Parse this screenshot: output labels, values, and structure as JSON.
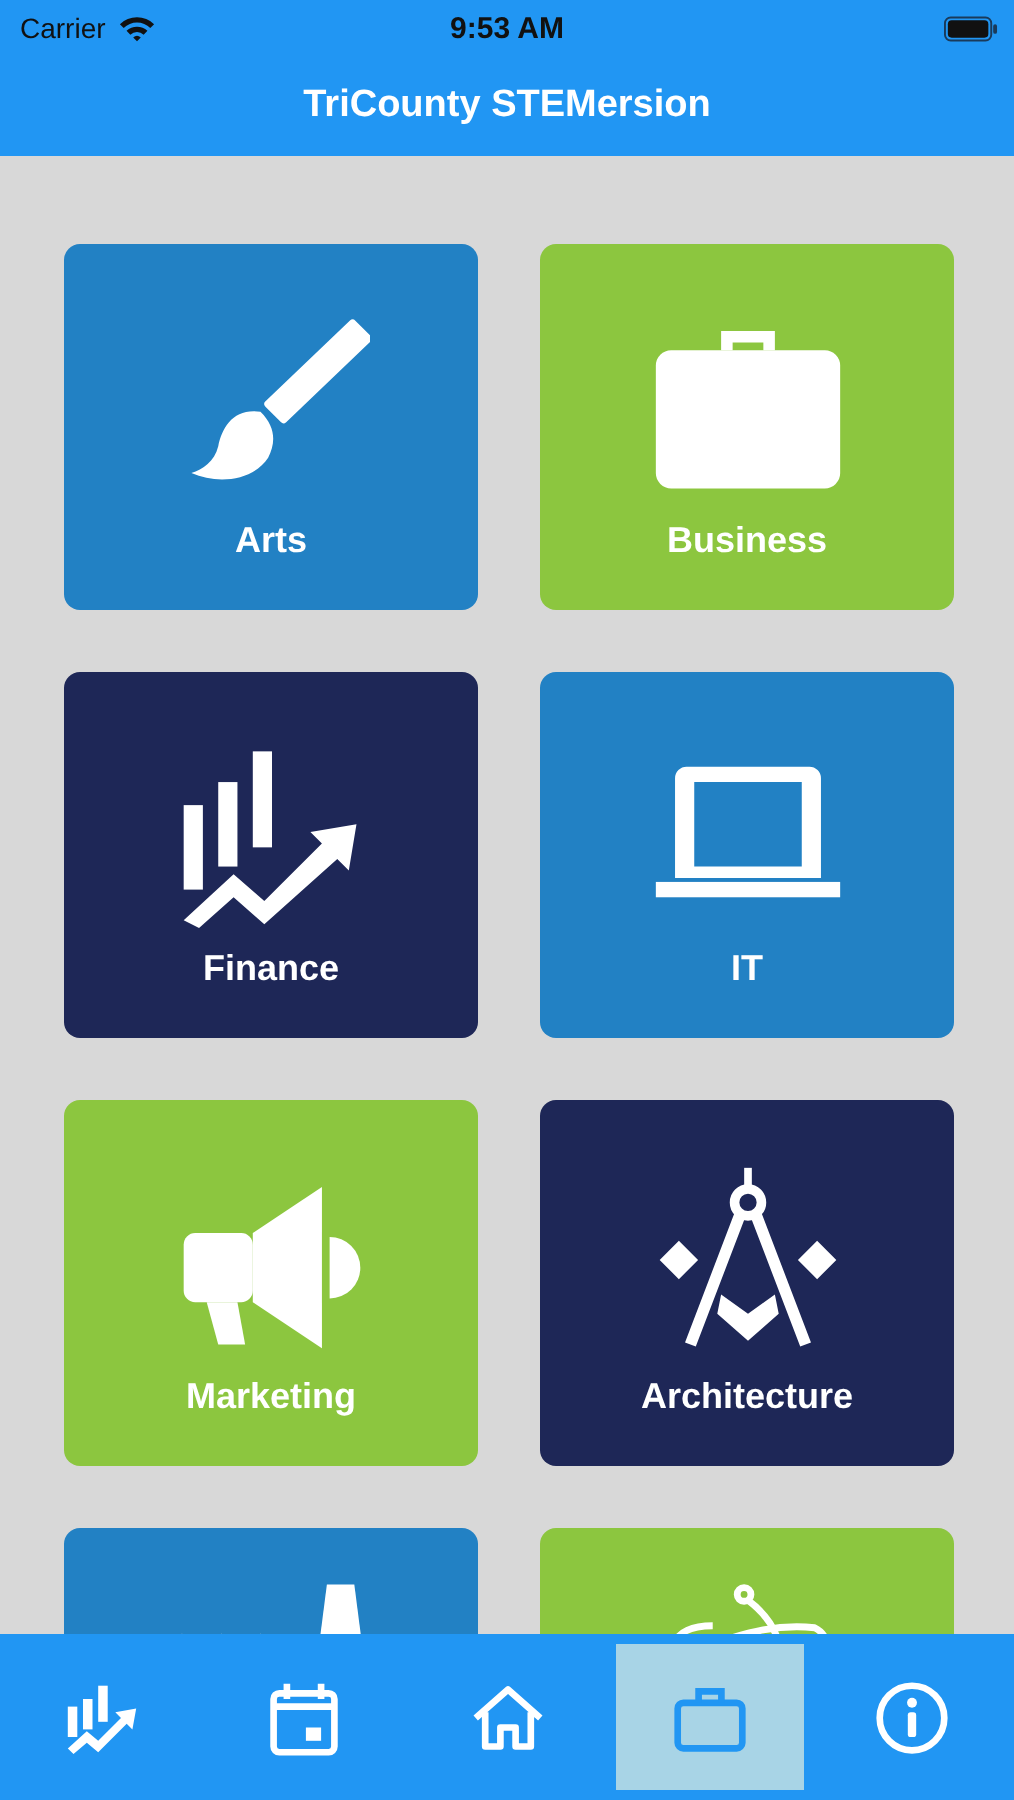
{
  "status_bar": {
    "carrier": "Carrier",
    "time": "9:53 AM"
  },
  "nav_bar": {
    "title": "TriCounty STEMersion"
  },
  "tiles": [
    {
      "label": "Arts",
      "color": "#2281c4"
    },
    {
      "label": "Business",
      "color": "#8cc63f"
    },
    {
      "label": "Finance",
      "color": "#1e2757"
    },
    {
      "label": "IT",
      "color": "#2281c4"
    },
    {
      "label": "Marketing",
      "color": "#8cc63f"
    },
    {
      "label": "Architecture",
      "color": "#1e2757"
    },
    {
      "color": "#2281c4"
    },
    {
      "color": "#8cc63f"
    }
  ],
  "tab_bar": [
    {
      "selected": false
    },
    {
      "selected": false
    },
    {
      "selected": false
    },
    {
      "selected": true
    },
    {
      "selected": false
    }
  ]
}
